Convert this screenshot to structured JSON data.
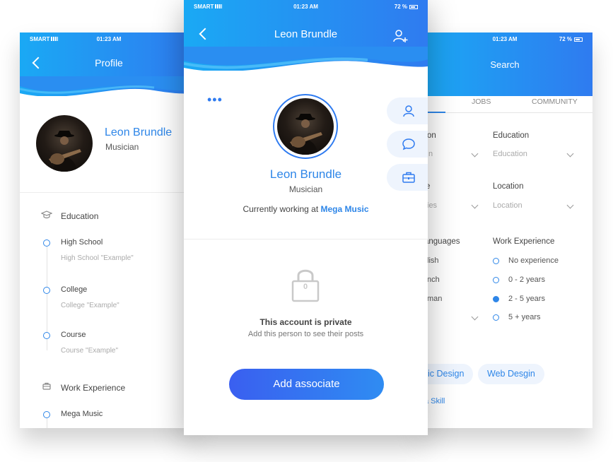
{
  "left_phone": {
    "status": {
      "carrier": "SMART",
      "time": "01:23 AM"
    },
    "header_title": "Profile",
    "name": "Leon Brundle",
    "role": "Musician",
    "education": {
      "title": "Education",
      "items": [
        {
          "title": "High School",
          "subtitle": "High School \"Example\""
        },
        {
          "title": "College",
          "subtitle": "College \"Example\""
        },
        {
          "title": "Course",
          "subtitle": "Course \"Example\""
        }
      ]
    },
    "work": {
      "title": "Work Experience",
      "items": [
        {
          "title": "Mega Music"
        }
      ]
    }
  },
  "middle_phone": {
    "status": {
      "carrier": "SMART",
      "time": "01:23 AM",
      "battery": "72 %"
    },
    "header_title": "Leon Brundle",
    "more": "•••",
    "name": "Leon Brundle",
    "role": "Musician",
    "working_prefix": "Currently working at ",
    "working_company": "Mega Music",
    "lock_number": "0",
    "private_title": "This account is private",
    "private_sub": "Add this person to see their posts",
    "button_label": "Add associate"
  },
  "right_phone": {
    "status": {
      "time": "01:23 AM",
      "battery": "72 %"
    },
    "header_title": "Search",
    "tabs": [
      "JOBS",
      "COMMUNITY"
    ],
    "col1_labels": {
      "a": "on",
      "a_value": "n",
      "b": "e",
      "b_value": "ies",
      "c": "anguages"
    },
    "col1_languages": [
      "lish",
      "nch",
      "man"
    ],
    "education_label": "Education",
    "education_value": "Education",
    "location_label": "Location",
    "location_value": "Location",
    "work_label": "Work Experience",
    "work_options": [
      "No experience",
      "0 - 2 years",
      "2 - 5 years",
      "5 +  years"
    ],
    "work_selected_index": 2,
    "chips": [
      "ic Design",
      "Web Desgin"
    ],
    "add_skill": "a Skill"
  }
}
